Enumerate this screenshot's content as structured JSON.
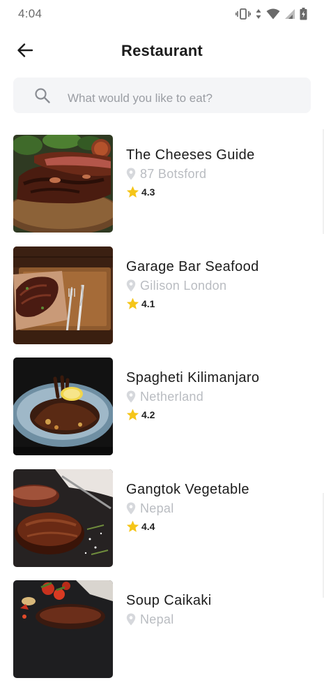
{
  "status_bar": {
    "time": "4:04",
    "icons": [
      "vibrate-icon",
      "data-arrows-icon",
      "wifi-icon",
      "signal-icon",
      "battery-charging-icon"
    ]
  },
  "header": {
    "title": "Restaurant",
    "back_icon": "arrow-left-icon"
  },
  "search": {
    "placeholder": "What would you like to eat?",
    "value": "",
    "icon": "search-icon"
  },
  "restaurants": [
    {
      "name": "The Cheeses Guide",
      "location": "87 Botsford",
      "rating": "4.3",
      "image": "grilled-ribs-photo"
    },
    {
      "name": "Garage Bar Seafood",
      "location": "Gilison London",
      "rating": "4.1",
      "image": "steak-on-board-photo"
    },
    {
      "name": "Spagheti Kilimanjaro",
      "location": "Netherland",
      "rating": "4.2",
      "image": "plated-steak-lemon-photo"
    },
    {
      "name": "Gangtok Vegetable",
      "location": "Nepal",
      "rating": "4.4",
      "image": "seared-meat-photo"
    },
    {
      "name": "Soup Caikaki",
      "location": "Nepal",
      "rating": "",
      "image": "meat-tomatoes-photo"
    }
  ],
  "colors": {
    "star": "#f5c518",
    "muted_text": "#b9bcc1",
    "search_bg": "#f4f5f7"
  }
}
